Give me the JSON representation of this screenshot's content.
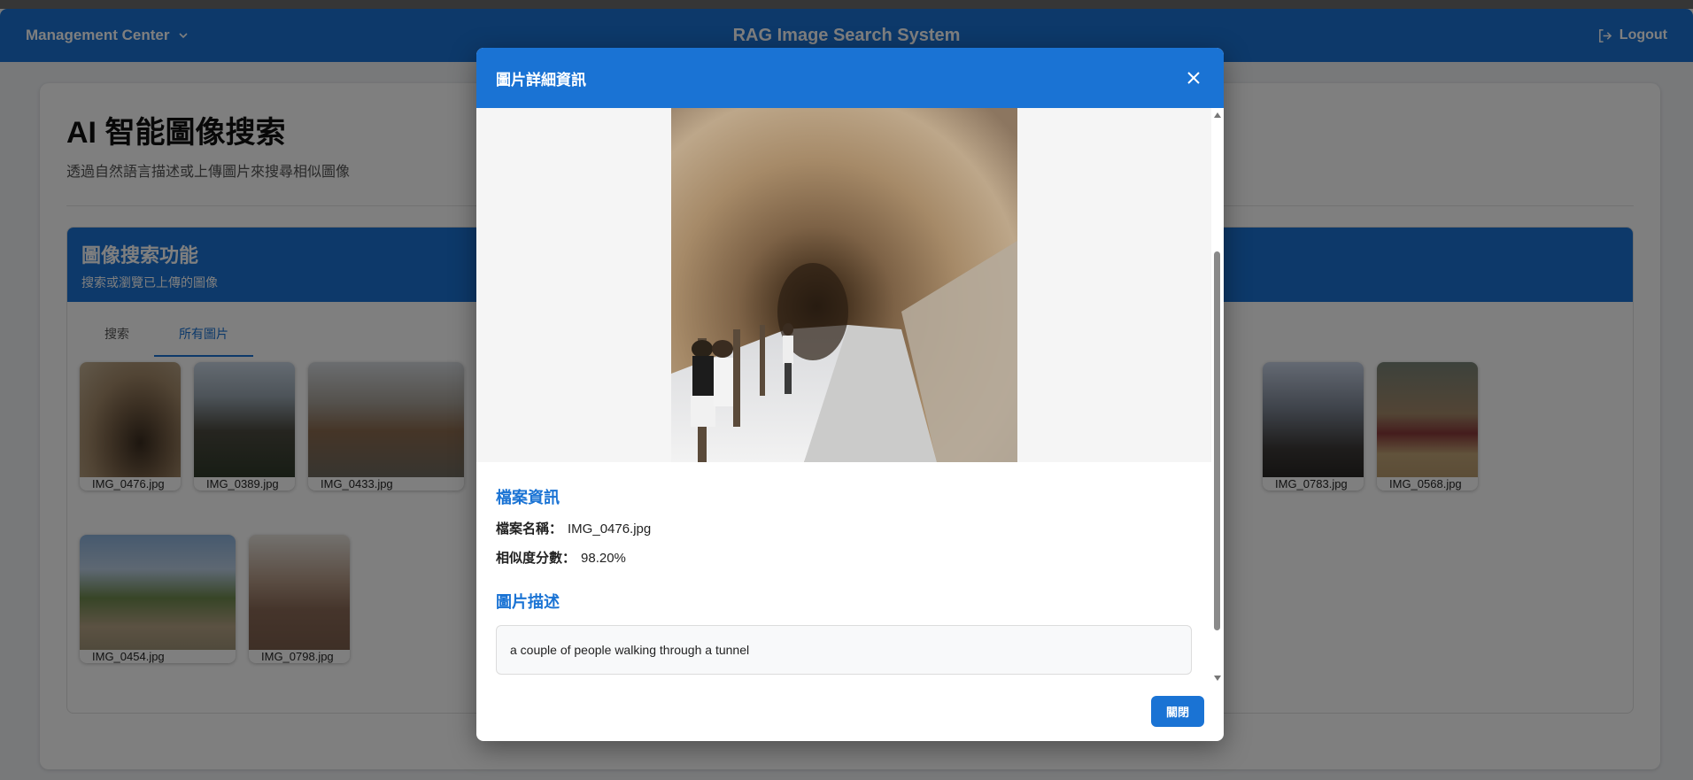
{
  "header": {
    "menu_label": "Management Center",
    "app_title": "RAG Image Search System",
    "logout_label": "Logout"
  },
  "page": {
    "title": "AI 智能圖像搜索",
    "subtitle": "透過自然語言描述或上傳圖片來搜尋相似圖像"
  },
  "section": {
    "title": "圖像搜索功能",
    "subtitle": "搜索或瀏覽已上傳的圖像",
    "tabs": [
      {
        "label": "搜索"
      },
      {
        "label": "所有圖片"
      }
    ]
  },
  "gallery": [
    {
      "filename": "IMG_0476.jpg",
      "icon": "image-thumbnail"
    },
    {
      "filename": "IMG_0389.jpg",
      "icon": "image-thumbnail"
    },
    {
      "filename": "IMG_0433.jpg",
      "icon": "image-thumbnail"
    },
    {
      "filename": "IMG_0783.jpg",
      "icon": "image-thumbnail"
    },
    {
      "filename": "IMG_0568.jpg",
      "icon": "image-thumbnail"
    },
    {
      "filename": "IMG_0454.jpg",
      "icon": "image-thumbnail"
    },
    {
      "filename": "IMG_0798.jpg",
      "icon": "image-thumbnail"
    }
  ],
  "modal": {
    "title": "圖片詳細資訊",
    "file_info_heading": "檔案資訊",
    "filename_label": "檔案名稱：",
    "filename_value": "IMG_0476.jpg",
    "similarity_label": "相似度分數：",
    "similarity_value": "98.20%",
    "description_heading": "圖片描述",
    "description": "a couple of people walking through a tunnel",
    "close_button": "關閉"
  },
  "colors": {
    "primary": "#1a73d4",
    "overlay": "rgba(0,0,0,0.5)"
  }
}
